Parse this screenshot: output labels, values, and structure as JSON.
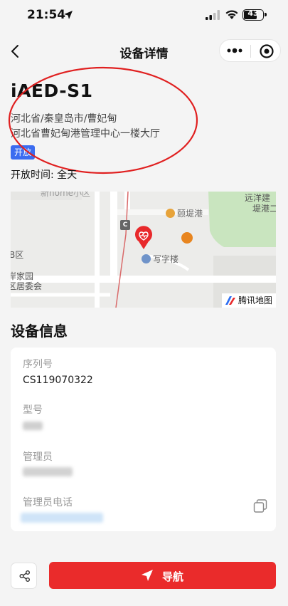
{
  "status_bar": {
    "time": "21:54",
    "battery": "43",
    "icons": [
      "location-arrow-icon",
      "signal-icon",
      "wifi-icon",
      "battery-icon"
    ]
  },
  "nav": {
    "title": "设备详情",
    "icons": [
      "chevron-left-icon",
      "more-dots-icon",
      "target-icon"
    ]
  },
  "device": {
    "name": "iAED-S1",
    "address_line1": "河北省/秦皇岛市/曹妃甸",
    "address_line2": "河北省曹妃甸港管理中心一楼大厅",
    "status_badge": "开放",
    "open_hours_label": "开放时间:",
    "open_hours_value": "全天"
  },
  "map": {
    "labels": {
      "top_left": "新home小区",
      "poi_port": "颐堤港",
      "poi_office": "写字楼",
      "right_top1": "远洋建",
      "right_top2": "堤港二",
      "left_mid": "B区",
      "left_bottom1": "岸家园",
      "left_bottom2": "区居委会",
      "road_marker": "C"
    },
    "brand": "腾讯地图",
    "colors": {
      "pin": "#e8292b",
      "park": "#c8e6c0",
      "road": "#ffffff",
      "base": "#ececea"
    }
  },
  "info": {
    "section_title": "设备信息",
    "serial_label": "序列号",
    "serial_value": "CS119070322",
    "model_label": "型号",
    "admin_label": "管理员",
    "admin_phone_label": "管理员电话"
  },
  "footer": {
    "navigate_label": "导航",
    "accent": "#ea2b2b"
  }
}
